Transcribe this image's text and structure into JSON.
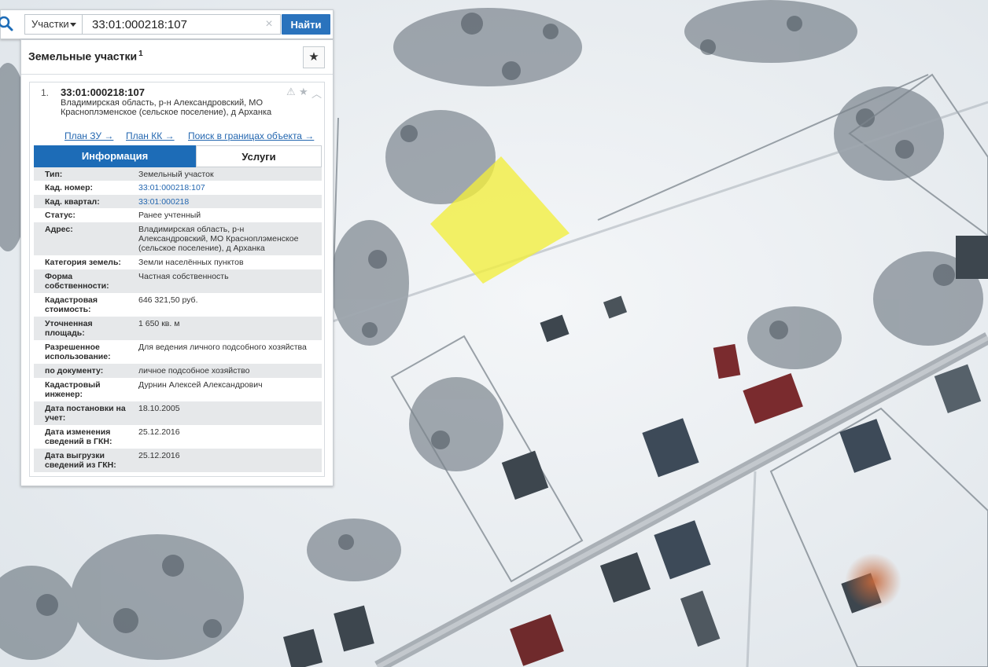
{
  "search": {
    "type_select_label": "Участки",
    "query_value": "33:01:000218:107",
    "clear_glyph": "×",
    "find_button_label": "Найти"
  },
  "panel": {
    "title": "Земельные участки",
    "count": "1",
    "favorite_icon": "star-icon"
  },
  "result": {
    "index": "1.",
    "cadastral_number": "33:01:000218:107",
    "address": "Владимирская область, р-н Александровский, МО Красноплэменское (сельское поселение), д Арханка",
    "links": [
      {
        "label": "План ЗУ →"
      },
      {
        "label": "План КК →"
      },
      {
        "label": "Поиск в границах объекта →"
      }
    ],
    "tabs": {
      "info": "Информация",
      "services": "Услуги"
    },
    "rows": [
      {
        "label": "Тип:",
        "value": "Земельный участок"
      },
      {
        "label": "Кад. номер:",
        "value": "33:01:000218:107"
      },
      {
        "label": "Кад. квартал:",
        "value": "33:01:000218"
      },
      {
        "label": "Статус:",
        "value": "Ранее учтенный"
      },
      {
        "label": "Адрес:",
        "value": "Владимирская область, р-н Александровский, МО Красноплэменское (сельское поселение), д Арханка"
      },
      {
        "label": "Категория земель:",
        "value": "Земли населённых пунктов"
      },
      {
        "label": "Форма собственности:",
        "value": "Частная собственность"
      },
      {
        "label": "Кадастровая стоимость:",
        "value": "646 321,50 руб."
      },
      {
        "label": "Уточненная площадь:",
        "value": "1 650 кв. м"
      },
      {
        "label": "Разрешенное использование:",
        "value": "Для ведения личного подсобного хозяйства"
      },
      {
        "label": "по документу:",
        "value": "личное подсобное хозяйство"
      },
      {
        "label": "Кадастровый инженер:",
        "value": "Дурнин Алексей Александрович"
      },
      {
        "label": "Дата постановки на учет:",
        "value": "18.10.2005"
      },
      {
        "label": "Дата изменения сведений в ГКН:",
        "value": "25.12.2016"
      },
      {
        "label": "Дата выгрузки сведений из ГКН:",
        "value": "25.12.2016"
      }
    ]
  },
  "colors": {
    "accent": "#1d6cb7",
    "link": "#2467b0",
    "parcel_fill": "#f2ee3c"
  }
}
